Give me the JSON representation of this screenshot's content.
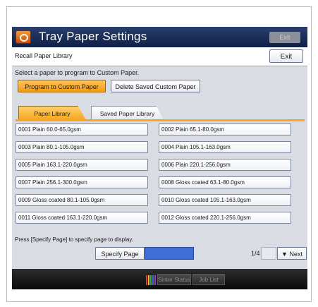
{
  "window": {
    "title": "Tray Paper Settings",
    "title_exit_label": "Exit"
  },
  "recall_bar": {
    "label": "Recall Paper Library",
    "exit_label": "Exit"
  },
  "instruction": "Select a paper to program to Custom Paper.",
  "actions": {
    "program_label": "Program to Custom Paper",
    "delete_label": "Delete Saved Custom Paper"
  },
  "tabs": [
    {
      "label": "Paper Library",
      "active": true
    },
    {
      "label": "Saved Paper Library",
      "active": false
    }
  ],
  "papers": [
    "0001 Plain 60.0-65.0gsm",
    "0002 Plain 65.1-80.0gsm",
    "0003 Plain 80.1-105.0gsm",
    "0004 Plain 105.1-163.0gsm",
    "0005 Plain 163.1-220.0gsm",
    "0006 Plain 220.1-256.0gsm",
    "0007 Plain 256.1-300.0gsm",
    "0008 Gloss coated 63.1-80.0gsm",
    "0009 Gloss coated 80.1-105.0gsm",
    "0010 Gloss coated 105.1-163.0gsm",
    "0011 Gloss coated 163.1-220.0gsm",
    "0012 Gloss coated 220.1-256.0gsm"
  ],
  "hint": "Press [Specify Page] to specify page to display.",
  "pager": {
    "specify_label": "Specify Page",
    "page_indicator": "1/4",
    "prev_label": "",
    "next_label": "▼ Next"
  },
  "footer": {
    "status_label": "Sinter Status",
    "joblist_label": "Job List"
  },
  "icons": [
    "camera-icon",
    "status-bars-icon"
  ],
  "colors": {
    "titlebar": "#0f1f47",
    "accent_orange": "#f5a623",
    "highlight_blue": "#3f6fd6"
  }
}
